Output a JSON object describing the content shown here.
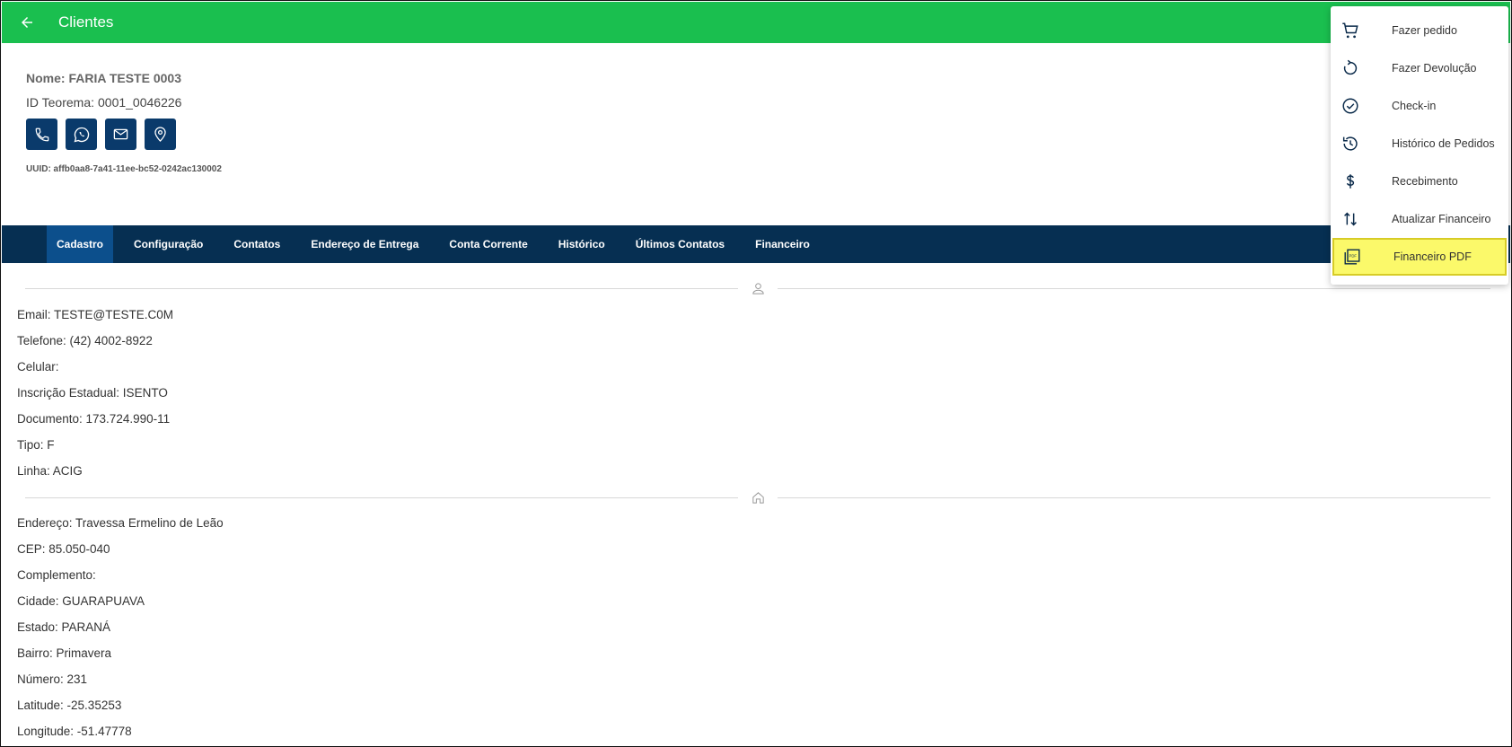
{
  "header": {
    "title": "Clientes",
    "back_icon": "arrow-left-icon"
  },
  "client": {
    "name_label": "Nome:",
    "name": "FARIA TESTE 0003",
    "id_label": "ID Teorema:",
    "id_value": "0001_0046226",
    "uuid": "UUID: affb0aa8-7a41-11ee-bc52-0242ac130002",
    "contact_icons": [
      "phone-icon",
      "whatsapp-icon",
      "mail-icon",
      "location-pin-icon"
    ]
  },
  "tabs": [
    {
      "label": "Cadastro",
      "active": true
    },
    {
      "label": "Configuração"
    },
    {
      "label": "Contatos"
    },
    {
      "label": "Endereço de Entrega"
    },
    {
      "label": "Conta Corrente"
    },
    {
      "label": "Histórico"
    },
    {
      "label": "Últimos Contatos"
    },
    {
      "label": "Financeiro"
    }
  ],
  "personal": [
    "Email: TESTE@TESTE.C0M",
    "Telefone: (42) 4002-8922",
    "Celular:",
    "Inscrição Estadual: ISENTO",
    "Documento: 173.724.990-11",
    "Tipo: F",
    "Linha: ACIG"
  ],
  "address": [
    "Endereço: Travessa Ermelino de Leão",
    "CEP: 85.050-040",
    "Complemento:",
    "Cidade: GUARAPUAVA",
    "Estado: PARANÁ",
    "Bairro: Primavera",
    "Número: 231",
    "Latitude: -25.35253",
    "Longitude: -51.47778"
  ],
  "menu": [
    {
      "label": "Fazer pedido",
      "icon": "cart-icon"
    },
    {
      "label": "Fazer Devolução",
      "icon": "refresh-icon"
    },
    {
      "label": "Check-in",
      "icon": "check-circle-icon"
    },
    {
      "label": "Histórico de Pedidos",
      "icon": "history-icon"
    },
    {
      "label": "Recebimento",
      "icon": "dollar-icon"
    },
    {
      "label": "Atualizar Financeiro",
      "icon": "swap-vertical-icon"
    },
    {
      "label": "Financeiro PDF",
      "icon": "pdf-icon",
      "highlighted": true
    }
  ],
  "colors": {
    "header_green": "#1abf4f",
    "tabbar_navy": "#062f52",
    "highlight_yellow": "#fbf96a"
  }
}
